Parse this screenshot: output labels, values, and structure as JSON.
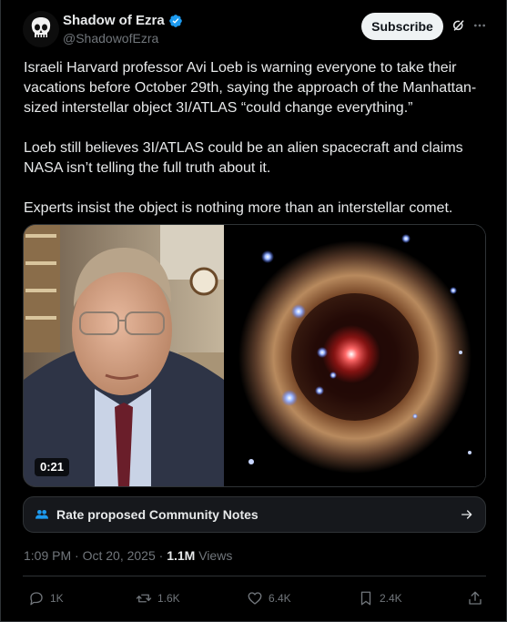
{
  "author": {
    "display_name": "Shadow of Ezra",
    "handle": "@ShadowofEzra",
    "verified": true,
    "verified_color": "#1d9bf0"
  },
  "header": {
    "subscribe_label": "Subscribe",
    "grok_icon": "grok-icon",
    "more_icon": "more-icon"
  },
  "tweet": {
    "paragraphs": [
      "Israeli Harvard professor Avi Loeb is warning everyone to take their vacations before October 29th, saying the approach of the Manhattan-sized interstellar object 3I/ATLAS “could change everything.”",
      "Loeb still believes 3I/ATLAS could be an alien spacecraft and claims NASA isn’t telling the full truth about it.",
      "Experts insist the object is nothing more than an interstellar comet."
    ]
  },
  "media": {
    "duration": "0:21"
  },
  "community_notes": {
    "label": "Rate proposed Community Notes",
    "icon": "people-icon",
    "accent": "#1d9bf0"
  },
  "meta": {
    "time": "1:09 PM",
    "separator1": " · ",
    "date": "Oct 20, 2025",
    "separator2": " · ",
    "views_count": "1.1M",
    "views_label": " Views"
  },
  "actions": {
    "replies": "1K",
    "reposts": "1.6K",
    "likes": "6.4K",
    "bookmarks": "2.4K"
  }
}
